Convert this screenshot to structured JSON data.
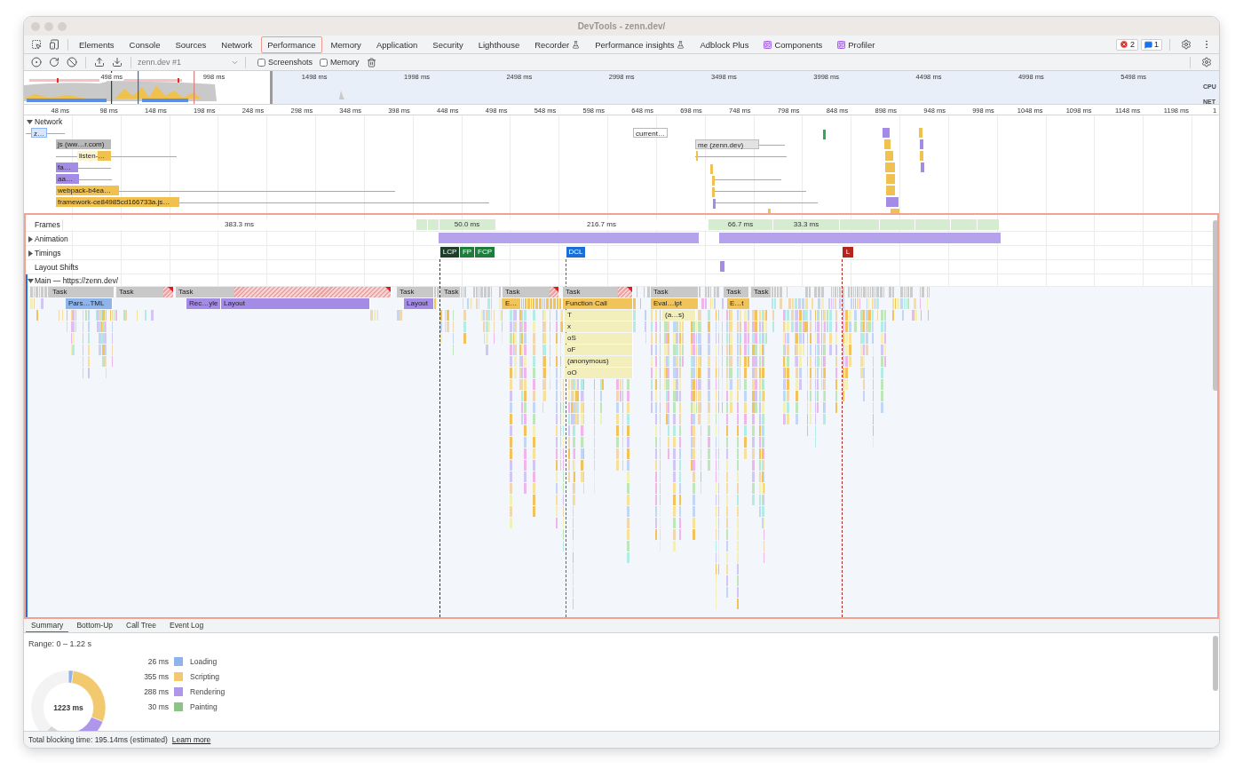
{
  "window": {
    "title": "DevTools - zenn.dev/"
  },
  "panel_tabs": [
    {
      "label": "Elements",
      "kind": "plain",
      "selected": false
    },
    {
      "label": "Console",
      "kind": "plain",
      "selected": false
    },
    {
      "label": "Sources",
      "kind": "plain",
      "selected": false
    },
    {
      "label": "Network",
      "kind": "plain",
      "selected": false
    },
    {
      "label": "Performance",
      "kind": "plain",
      "selected": true
    },
    {
      "label": "Memory",
      "kind": "plain",
      "selected": false
    },
    {
      "label": "Application",
      "kind": "plain",
      "selected": false
    },
    {
      "label": "Security",
      "kind": "plain",
      "selected": false
    },
    {
      "label": "Lighthouse",
      "kind": "plain",
      "selected": false
    },
    {
      "label": "Recorder",
      "kind": "experiment",
      "selected": false
    },
    {
      "label": "Performance insights",
      "kind": "experiment",
      "selected": false
    },
    {
      "label": "Adblock Plus",
      "kind": "plain",
      "selected": false
    },
    {
      "label": "Components",
      "kind": "extension",
      "selected": false
    },
    {
      "label": "Profiler",
      "kind": "extension",
      "selected": false
    }
  ],
  "issue_badges": [
    {
      "kind": "error",
      "count": "2"
    },
    {
      "kind": "message",
      "count": "1"
    }
  ],
  "toolbar": {
    "recording": "zenn.dev #1",
    "options": [
      {
        "label": "Screenshots",
        "checked": false
      },
      {
        "label": "Memory",
        "checked": false
      }
    ]
  },
  "overview": {
    "ticks": [
      "498 ms",
      "998 ms",
      "1498 ms",
      "1998 ms",
      "2498 ms",
      "2998 ms",
      "3498 ms",
      "3998 ms",
      "4498 ms",
      "4998 ms",
      "5498 ms"
    ],
    "lanes": [
      "CPU",
      "NET"
    ]
  },
  "ruler": [
    "48 ms",
    "98 ms",
    "148 ms",
    "198 ms",
    "248 ms",
    "298 ms",
    "348 ms",
    "398 ms",
    "448 ms",
    "498 ms",
    "548 ms",
    "598 ms",
    "648 ms",
    "698 ms",
    "748 ms",
    "798 ms",
    "848 ms",
    "898 ms",
    "948 ms",
    "998 ms",
    "1048 ms",
    "1098 ms",
    "1148 ms",
    "1198 ms",
    "1"
  ],
  "network": {
    "label": "Network",
    "expanded": true,
    "requests": [
      {
        "label": "z…",
        "kind": "document"
      },
      {
        "label": "js (ww…r.com)",
        "kind": "third_party"
      },
      {
        "label": "listen-…",
        "kind": "script_pending"
      },
      {
        "label": "fa…",
        "kind": "style"
      },
      {
        "label": "aa…",
        "kind": "style"
      },
      {
        "label": "webpack-b4ea…",
        "kind": "script"
      },
      {
        "label": "framework-ce84985cd166733a.js…",
        "kind": "script"
      },
      {
        "label": "current…",
        "kind": "fetch"
      },
      {
        "label": "me (zenn.dev)",
        "kind": "other"
      }
    ]
  },
  "tracks": {
    "frames": {
      "label": "Frames",
      "items": [
        {
          "label": "383.3 ms",
          "presented": false
        },
        {
          "label": "50.0 ms",
          "presented": true
        },
        {
          "label": "216.7 ms",
          "presented": false
        },
        {
          "label": "66.7 ms",
          "presented": true
        },
        {
          "label": "33.3 ms",
          "presented": true
        }
      ]
    },
    "animation": {
      "label": "Animation",
      "expanded": false
    },
    "timings": {
      "label": "Timings",
      "expanded": false,
      "markers": [
        {
          "label": "LCP",
          "color": "#1f3d2b"
        },
        {
          "label": "FP",
          "color": "#1e7d3a"
        },
        {
          "label": "FCP",
          "color": "#1e7d3a"
        },
        {
          "label": "DCL",
          "color": "#1a6fd6"
        },
        {
          "label": "L",
          "color": "#b3261e"
        }
      ]
    },
    "layout_shifts": {
      "label": "Layout Shifts"
    },
    "main": {
      "label": "Main — https://zenn.dev/",
      "expanded": true,
      "tasks": [
        {
          "label": "Task",
          "long": false
        },
        {
          "label": "Task",
          "long": true
        },
        {
          "label": "Task",
          "long": true
        },
        {
          "label": "Task",
          "long": false
        },
        {
          "label": "Task",
          "long": false
        },
        {
          "label": "Task",
          "long": true
        },
        {
          "label": "Task",
          "long": true
        },
        {
          "label": "Task",
          "long": false
        },
        {
          "label": "Task",
          "long": false
        },
        {
          "label": "Task",
          "long": false
        }
      ],
      "events": [
        {
          "label": "Pars…TML",
          "kind": "loading"
        },
        {
          "label": "Rec…yle",
          "kind": "rendering"
        },
        {
          "label": "Layout",
          "kind": "rendering"
        },
        {
          "label": "Layout",
          "kind": "rendering"
        },
        {
          "label": "E…",
          "kind": "scripting"
        },
        {
          "label": "Function Call",
          "kind": "scripting",
          "children": [
            {
              "label": "T",
              "kind": "function",
              "children": [
                {
                  "label": "x",
                  "kind": "function",
                  "children": [
                    {
                      "label": "oS",
                      "kind": "function",
                      "children": [
                        {
                          "label": "oF",
                          "kind": "function",
                          "children": [
                            {
                              "label": "(anonymous)",
                              "kind": "function",
                              "children": [
                                {
                                  "label": "oO",
                                  "kind": "function"
                                }
                              ]
                            }
                          ]
                        }
                      ]
                    }
                  ]
                }
              ]
            }
          ]
        },
        {
          "label": "Eval…ipt",
          "kind": "scripting",
          "children": [
            {
              "label": "(a…s)",
              "kind": "function"
            }
          ]
        },
        {
          "label": "E…t",
          "kind": "scripting"
        }
      ]
    }
  },
  "details": {
    "tabs": [
      {
        "label": "Summary",
        "selected": true
      },
      {
        "label": "Bottom-Up",
        "selected": false
      },
      {
        "label": "Call Tree",
        "selected": false
      },
      {
        "label": "Event Log",
        "selected": false
      }
    ],
    "range": "Range: 0 – 1.22 s",
    "total": "1223 ms",
    "categories": [
      {
        "time": "26 ms",
        "label": "Loading",
        "color": "#8fb4ea"
      },
      {
        "time": "355 ms",
        "label": "Scripting",
        "color": "#f2c96e"
      },
      {
        "time": "288 ms",
        "label": "Rendering",
        "color": "#ae97ea"
      },
      {
        "time": "30 ms",
        "label": "Painting",
        "color": "#8cc386"
      }
    ]
  },
  "footer": {
    "text": "Total blocking time: 195.14ms (estimated)",
    "link": "Learn more"
  }
}
